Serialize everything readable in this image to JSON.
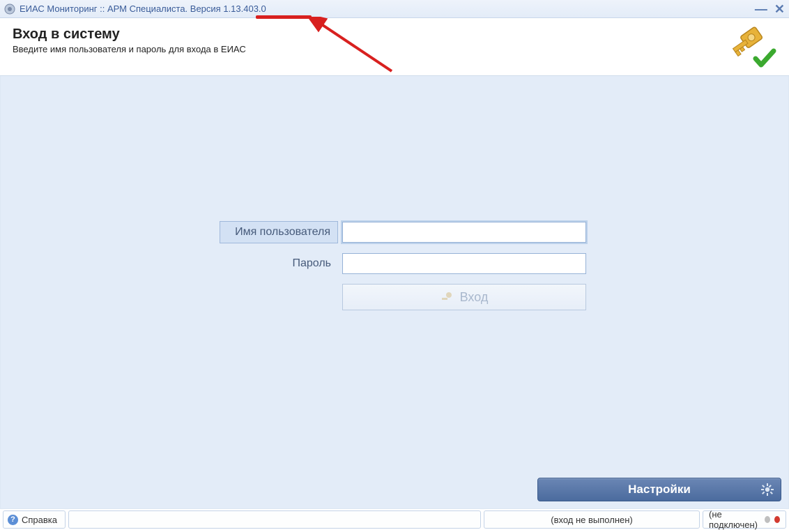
{
  "titlebar": {
    "text": "ЕИАС Мониторинг :: АРМ Специалиста. Версия 1.13.403.0"
  },
  "header": {
    "title": "Вход в систему",
    "subtitle": "Введите имя пользователя и пароль для входа в ЕИАС"
  },
  "form": {
    "username_label": "Имя пользователя",
    "password_label": "Пароль",
    "username_value": "",
    "password_value": "",
    "submit_label": "Вход"
  },
  "settings_button": "Настройки",
  "statusbar": {
    "help": "Справка",
    "login_status": "(вход не выполнен)",
    "conn_status": "(не подключен)"
  }
}
